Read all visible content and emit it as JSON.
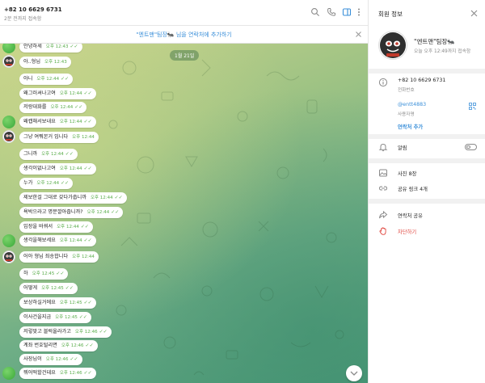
{
  "chat": {
    "title": "+82 10 6629 6731",
    "status": "2분 전까지 접속함",
    "banner": "\"엔트맨\"팀장🐜 님을 연락처에 추가하기",
    "date_pill": "1월 21일",
    "messages": [
      {
        "text": "안녕하세",
        "time": "오후 12:43",
        "read": true,
        "partial": true
      },
      {
        "text": "아..형님",
        "time": "오후 12:43",
        "read": false
      },
      {
        "text": "아니",
        "time": "오후 12:44",
        "read": true
      },
      {
        "text": "왜그러셔나고여",
        "time": "오후 12:44",
        "read": true
      },
      {
        "text": "저랑대화를",
        "time": "오후 12:44",
        "read": true
      },
      {
        "text": "왜캡해서보내요",
        "time": "오후 12:44",
        "read": true
      },
      {
        "text": "그냥 여쭤본거 입니다",
        "time": "오후 12:44",
        "read": false
      },
      {
        "text": "그니까",
        "time": "오후 12:44",
        "read": true
      },
      {
        "text": "생각이없나고여",
        "time": "오후 12:44",
        "read": true
      },
      {
        "text": "누가",
        "time": "오후 12:44",
        "read": true
      },
      {
        "text": "제보한걸 그대로 갖다가줍니까",
        "time": "오후 12:44",
        "read": true
      },
      {
        "text": "욕박으라고 명분깔아줍니까?",
        "time": "오후 12:44",
        "read": true
      },
      {
        "text": "입장을 바꿔서",
        "time": "오후 12:44",
        "read": true
      },
      {
        "text": "생각을해보세요",
        "time": "오후 12:44",
        "read": true
      },
      {
        "text": "어아 형님 죄송합니다",
        "time": "오후 12:44",
        "read": false
      },
      {
        "text": "하",
        "time": "오후 12:45",
        "read": true
      },
      {
        "text": "어떻게",
        "time": "오후 12:45",
        "read": true
      },
      {
        "text": "보상하실거에요",
        "time": "오후 12:45",
        "read": true
      },
      {
        "text": "이사건을지금",
        "time": "오후 12:45",
        "read": true
      },
      {
        "text": "저렇맞고 블럭올라가고",
        "time": "오후 12:46",
        "read": true
      },
      {
        "text": "계좌 번호털리면",
        "time": "오후 12:46",
        "read": true
      },
      {
        "text": "사장님이",
        "time": "오후 12:46",
        "read": true
      },
      {
        "text": "뭐어떡할건데요",
        "time": "오후 12:46",
        "read": true
      }
    ]
  },
  "panel": {
    "title": "회원 정보",
    "name": "\"엔트맨\"팀장🐜",
    "status": "오늘 오후 12:49까지 접속함",
    "phone": "+82 10 6629 6731",
    "phone_label": "전화번호",
    "username": "@entt4883",
    "username_label": "사용자명",
    "add_contact": "연락처 추가",
    "notifications": "알림",
    "notifications_on": false,
    "photos": "사진 8장",
    "shared_links": "공유 링크 4개",
    "share_contact": "연락처 공유",
    "block": "차단하기"
  },
  "colors": {
    "accent": "#3a8fd9",
    "danger": "#e0463f",
    "read_tick": "#5cae4e",
    "chat_bg": "#8fbf84"
  },
  "icons": [
    "search-icon",
    "phone-icon",
    "sidebar-toggle-icon",
    "more-vertical-icon",
    "close-icon",
    "info-icon",
    "qr-code-icon",
    "bell-icon",
    "photo-icon",
    "link-icon",
    "share-icon",
    "block-hand-icon",
    "chevron-down-icon"
  ]
}
